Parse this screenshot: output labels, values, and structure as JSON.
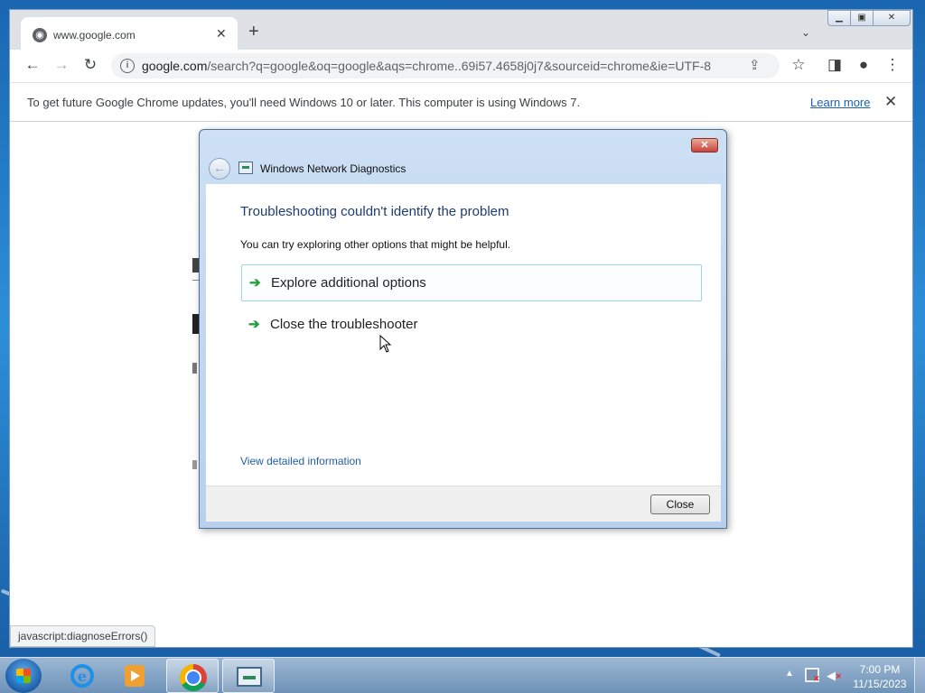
{
  "browser": {
    "tab_title": "www.google.com",
    "new_tab_symbol": "+",
    "url_host": "google.com",
    "url_path": "/search?q=google&oq=google&aqs=chrome..69i57.4658j0j7&sourceid=chrome&ie=UTF-8",
    "infobar_text": "To get future Google Chrome updates, you'll need Windows 10 or later. This computer is using Windows 7.",
    "infobar_link": "Learn more",
    "status_text": "javascript:diagnoseErrors()"
  },
  "dialog": {
    "window_title": "Windows Network Diagnostics",
    "heading": "Troubleshooting couldn't identify the problem",
    "subtext": "You can try exploring other options that might be helpful.",
    "options": [
      {
        "label": "Explore additional options"
      },
      {
        "label": "Close the troubleshooter"
      }
    ],
    "details_link": "View detailed information",
    "close_button": "Close"
  },
  "taskbar": {
    "clock_time": "7:00 PM",
    "clock_date": "11/15/2023"
  },
  "colors": {
    "dialog_heading": "#1e3c72",
    "link": "#1f5fa8",
    "option_arrow": "#27a03a"
  }
}
